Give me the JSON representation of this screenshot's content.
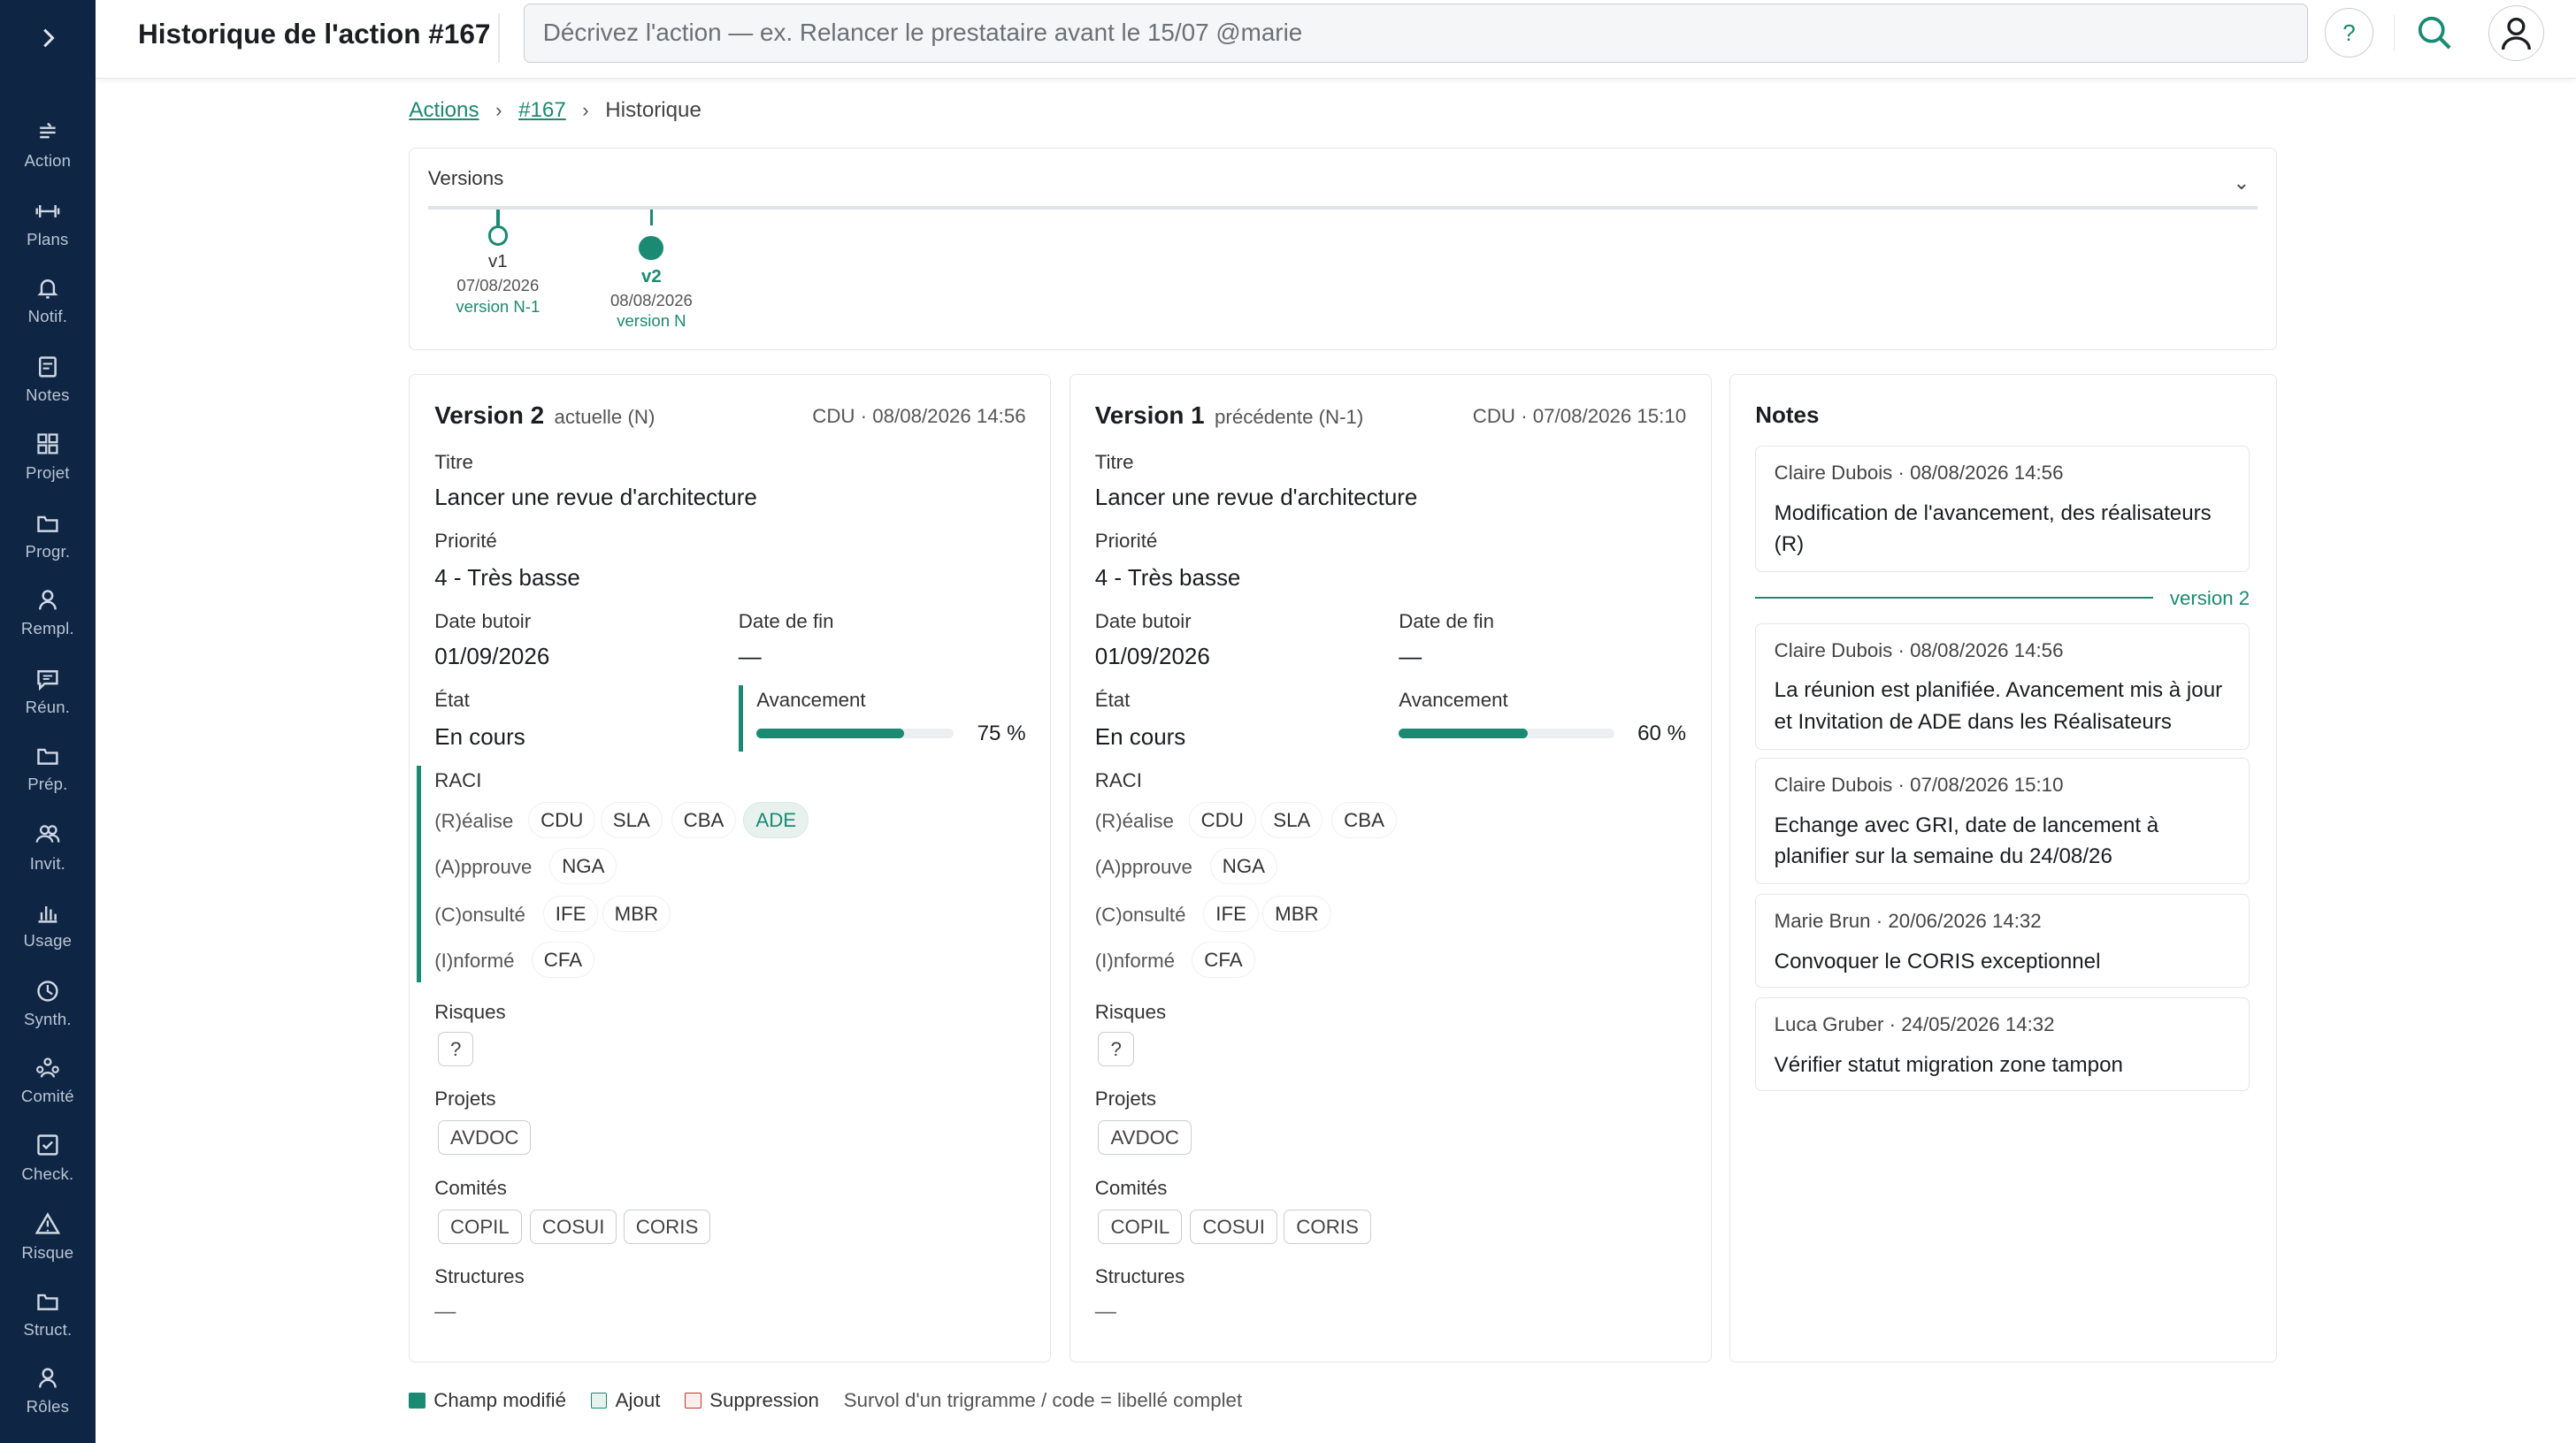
{
  "header": {
    "title": "Historique de l'action #167",
    "input_placeholder": "Décrivez l'action — ex. Relancer le prestataire avant le 15/07 @marie",
    "help_label": "?"
  },
  "sidebar": {
    "items": [
      {
        "label": "Action",
        "icon": "action-icon"
      },
      {
        "label": "Plans",
        "icon": "plans-icon"
      },
      {
        "label": "Notif.",
        "icon": "bell-icon"
      },
      {
        "label": "Notes",
        "icon": "notes-icon"
      },
      {
        "label": "Projet",
        "icon": "grid-icon"
      },
      {
        "label": "Progr.",
        "icon": "folder-icon"
      },
      {
        "label": "Rempl.",
        "icon": "person-icon"
      },
      {
        "label": "Réun.",
        "icon": "chat-icon"
      },
      {
        "label": "Prép.",
        "icon": "folder-icon"
      },
      {
        "label": "Invit.",
        "icon": "people-icon"
      },
      {
        "label": "Usage",
        "icon": "bar-chart-icon"
      },
      {
        "label": "Synth.",
        "icon": "clock-icon"
      },
      {
        "label": "Comité",
        "icon": "group-icon"
      },
      {
        "label": "Check.",
        "icon": "checkbox-icon"
      },
      {
        "label": "Risque",
        "icon": "warning-icon"
      },
      {
        "label": "Struct.",
        "icon": "folder-icon"
      },
      {
        "label": "Rôles",
        "icon": "person-icon"
      }
    ]
  },
  "breadcrumb": {
    "root": "Actions",
    "item": "#167",
    "current": "Historique",
    "sep": "›"
  },
  "versions": {
    "title": "Versions",
    "chevron": "⌄",
    "nodes": [
      {
        "name": "v1",
        "date": "07/08/2026",
        "tag": "version N-1"
      },
      {
        "name": "v2",
        "date": "08/08/2026",
        "tag": "version N"
      }
    ]
  },
  "v2": {
    "title": "Version 2",
    "subtitle": "actuelle (N)",
    "meta": "CDU · 08/08/2026 14:56",
    "titre_label": "Titre",
    "titre": "Lancer une revue d'architecture",
    "prio_label": "Priorité",
    "prio": "4 - Très basse",
    "butoir_label": "Date butoir",
    "butoir": "01/09/2026",
    "fin_label": "Date de fin",
    "fin": "—",
    "etat_label": "État",
    "etat": "En cours",
    "av_label": "Avancement",
    "av_text": "75 %",
    "progress": 0.75,
    "raci_label": "RACI",
    "r_label": "(R)éalise",
    "r": [
      "CDU",
      "SLA",
      "CBA",
      "ADE"
    ],
    "a_label": "(A)pprouve",
    "a": [
      "NGA"
    ],
    "c_label": "(C)onsulté",
    "c": [
      "IFE",
      "MBR"
    ],
    "i_label": "(I)nformé",
    "i": [
      "CFA"
    ],
    "risques_label": "Risques",
    "risques": "?",
    "projets_label": "Projets",
    "projets": "AVDOC",
    "comites_label": "Comités",
    "comites": [
      "COPIL",
      "COSUI",
      "CORIS"
    ],
    "structures_label": "Structures",
    "structures": "—"
  },
  "v1": {
    "title": "Version 1",
    "subtitle": "précédente (N-1)",
    "meta": "CDU · 07/08/2026 15:10",
    "titre_label": "Titre",
    "titre": "Lancer une revue d'architecture",
    "prio_label": "Priorité",
    "prio": "4 - Très basse",
    "butoir_label": "Date butoir",
    "butoir": "01/09/2026",
    "fin_label": "Date de fin",
    "fin": "—",
    "etat_label": "État",
    "etat": "En cours",
    "av_label": "Avancement",
    "av_text": "60 %",
    "progress": 0.6,
    "raci_label": "RACI",
    "r_label": "(R)éalise",
    "r": [
      "CDU",
      "SLA",
      "CBA"
    ],
    "a_label": "(A)pprouve",
    "a": [
      "NGA"
    ],
    "c_label": "(C)onsulté",
    "c": [
      "IFE",
      "MBR"
    ],
    "i_label": "(I)nformé",
    "i": [
      "CFA"
    ],
    "risques_label": "Risques",
    "risques": "?",
    "projets_label": "Projets",
    "projets": "AVDOC",
    "comites_label": "Comités",
    "comites": [
      "COPIL",
      "COSUI",
      "CORIS"
    ],
    "structures_label": "Structures",
    "structures": "—"
  },
  "notes": {
    "title": "Notes",
    "version_marker": "version 2",
    "items": [
      {
        "meta": "Claire Dubois · 08/08/2026 14:56",
        "text": "Modification de l'avancement, des réalisateurs (R)"
      },
      {
        "meta": "Claire Dubois · 08/08/2026 14:56",
        "text": "La réunion est planifiée. Avancement mis à jour et Invitation de ADE dans les Réalisateurs"
      },
      {
        "meta": "Claire Dubois · 07/08/2026 15:10",
        "text": "Echange avec GRI, date de lancement à planifier sur la semaine du 24/08/26"
      },
      {
        "meta": "Marie Brun · 20/06/2026 14:32",
        "text": "Convoquer le CORIS exceptionnel"
      },
      {
        "meta": "Luca Gruber · 24/05/2026 14:32",
        "text": "Vérifier statut migration zone tampon"
      }
    ]
  },
  "legend": {
    "modified": "Champ modifié",
    "added": "Ajout",
    "removed": "Suppression",
    "hint": "Survol d'un trigramme / code = libellé complet"
  },
  "colors": {
    "accent": "#1a8a72",
    "sidebar": "#0f2544",
    "removed": "#c0392b"
  }
}
